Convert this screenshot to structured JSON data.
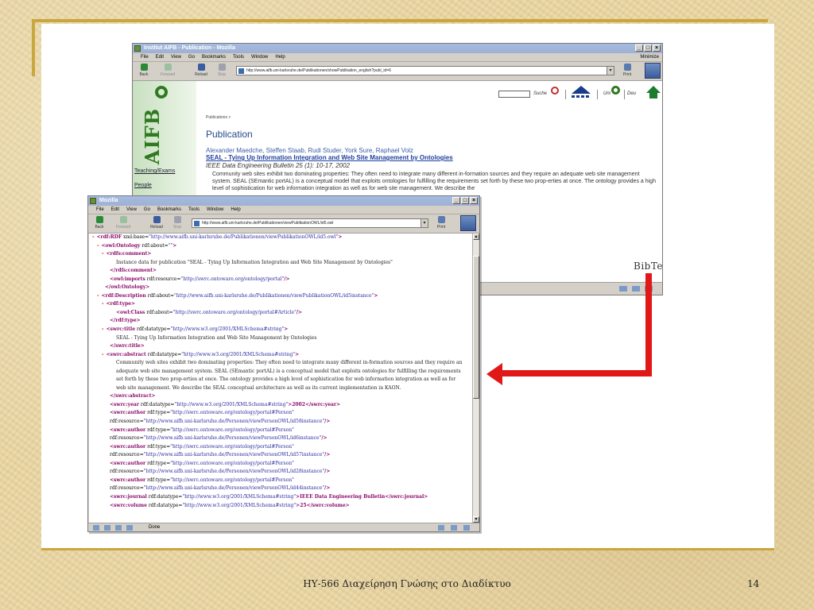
{
  "slide": {
    "footer_title": "ΗΥ-566 Διαχείρηση Γνώσης στο Διαδίκτυο",
    "page_number": "14",
    "accent_color": "#c9a63e",
    "arrow_color": "#e01818"
  },
  "browser1": {
    "title": "Institut AIFB - Publication - Mozilla",
    "menu": [
      "File",
      "Edit",
      "View",
      "Go",
      "Bookmarks",
      "Tools",
      "Window",
      "Help"
    ],
    "minimize_label": "Minimize",
    "toolbar": {
      "back": "Back",
      "forward": "Forward",
      "reload": "Reload",
      "stop": "Stop",
      "print": "Print"
    },
    "url": "http://www.aifb.uni-karlsruhe.de/Publikationen/showPublikation_english?publ_id=6",
    "sidebar": {
      "logo_text": "AIFB",
      "links": [
        "Teaching/Exams",
        "People"
      ]
    },
    "nav": {
      "search_label": "Suche",
      "uni_label": "Uni",
      "lang_label": "Deu"
    },
    "page": {
      "breadcrumb": "Publications >",
      "heading": "Publication",
      "authors": "Alexander Maedche, Steffen Staab, Rudi Studer, York Sure, Raphael Volz",
      "title_link": "SEAL - Tying Up Information Integration and Web Site Management by Ontologies",
      "venue": "IEEE Data Engineering Bulletin 25 (1): 10-17, 2002",
      "abstract": "Community web sites exhibit two dominating properties: They often need to integrate many different in-formation sources and they require an adequate web site management system. SEAL (SEmantic portAL) is a conceptual model that exploits ontologies for fulfilling the requirements set forth by these two prop-erties at once. The ontology provides a high level of sophistication for web information integration as well as for web site management. We describe the",
      "bibtex_label": "BibTeX"
    }
  },
  "browser2": {
    "title": "Mozilla",
    "menu": [
      "File",
      "Edit",
      "View",
      "Go",
      "Bookmarks",
      "Tools",
      "Window",
      "Help"
    ],
    "toolbar": {
      "back": "Back",
      "forward": "Forward",
      "reload": "Reload",
      "stop": "Stop",
      "print": "Print"
    },
    "url": "http://www.aifb.uni-karlsruhe.de/Publikationen/viewPublikationOWL/id5.owl",
    "status_text": "Done",
    "xml": {
      "l1": {
        "tag": "<rdf:RDF",
        "att": " xml:base=",
        "val": "\"http://www.aifb.uni-karlsruhe.de/Publikationen/viewPublikationOWL/id5.owl\"",
        "end": ">"
      },
      "l2": {
        "tag": "<owl:Ontology",
        "att": " rdf:about=",
        "val": "\"\"",
        "end": ">"
      },
      "l3": {
        "tag": "<rdfs:comment>"
      },
      "l4": {
        "text": "Instance data for publication \"SEAL - Tying Up Information Integration and Web Site Management by Ontologies\""
      },
      "l5": {
        "tag": "</rdfs:comment>"
      },
      "l6": {
        "tag": "<owl:imports",
        "att": " rdf:resource=",
        "val": "\"http://swrc.ontoware.org/ontology/portal\"",
        "end": "/>"
      },
      "l7": {
        "tag": "</owl:Ontology>"
      },
      "l8": {
        "tag": "<rdf:Description",
        "att": " rdf:about=",
        "val": "\"http://www.aifb.uni-karlsruhe.de/Publikationen/viewPublikationOWL/id5instance\"",
        "end": ">"
      },
      "l9": {
        "tag": "<rdf:type>"
      },
      "l10": {
        "tag": "<owl:Class",
        "att": " rdf:about=",
        "val": "\"http://swrc.ontoware.org/ontology/portal#Article\"",
        "end": "/>"
      },
      "l11": {
        "tag": "</rdf:type>"
      },
      "l12": {
        "tag": "<swrc:title",
        "att": " rdf:datatype=",
        "val": "\"http://www.w3.org/2001/XMLSchema#string\"",
        "end": ">"
      },
      "l13": {
        "text": "SEAL - Tying Up Information Integration and Web Site Management by Ontologies"
      },
      "l14": {
        "tag": "</swrc:title>"
      },
      "l15": {
        "tag": "<swrc:abstract",
        "att": " rdf:datatype=",
        "val": "\"http://www.w3.org/2001/XMLSchema#string\"",
        "end": ">"
      },
      "l16": {
        "text": "Community web sites exhibit two dominating properties: They often need to integrate many different in-formation sources and they require an"
      },
      "l17": {
        "text": "adequate web site management system. SEAL (SEmantic portAL) is a conceptual model that exploits ontologies for fulfilling the requirements"
      },
      "l18": {
        "text": "set forth by these two prop-erties at once. The ontology provides a high level of sophistication for web information integration as well as for"
      },
      "l19": {
        "text": "web site management. We describe the SEAL conceptual architecture as well as its current implementation in KAON."
      },
      "l20": {
        "tag": "</swrc:abstract>"
      },
      "l21": {
        "tag": "<swrc:year",
        "att": " rdf:datatype=",
        "val": "\"http://www.w3.org/2001/XMLSchema#string\"",
        "end": ">2002</swrc:year>"
      },
      "l22": {
        "tag": "<swrc:author",
        "att": " rdf:type=",
        "val": "\"http://swrc.ontoware.org/ontology/portal#Person\""
      },
      "l23": {
        "att": "rdf:resource=",
        "val": "\"http://www.aifb.uni-karlsruhe.de/Personen/viewPersonOWL/id58instance\"",
        "end": "/>"
      },
      "l24": {
        "tag": "<swrc:author",
        "att": " rdf:type=",
        "val": "\"http://swrc.ontoware.org/ontology/portal#Person\""
      },
      "l25": {
        "att": "rdf:resource=",
        "val": "\"http://www.aifb.uni-karlsruhe.de/Personen/viewPersonOWL/id6instance\"",
        "end": "/>"
      },
      "l26": {
        "tag": "<swrc:author",
        "att": " rdf:type=",
        "val": "\"http://swrc.ontoware.org/ontology/portal#Person\""
      },
      "l27": {
        "att": "rdf:resource=",
        "val": "\"http://www.aifb.uni-karlsruhe.de/Personen/viewPersonOWL/id57instance\"",
        "end": "/>"
      },
      "l28": {
        "tag": "<swrc:author",
        "att": " rdf:type=",
        "val": "\"http://swrc.ontoware.org/ontology/portal#Person\""
      },
      "l29": {
        "att": "rdf:resource=",
        "val": "\"http://www.aifb.uni-karlsruhe.de/Personen/viewPersonOWL/id28instance\"",
        "end": "/>"
      },
      "l30": {
        "tag": "<swrc:author",
        "att": " rdf:type=",
        "val": "\"http://swrc.ontoware.org/ontology/portal#Person\""
      },
      "l31": {
        "att": "rdf:resource=",
        "val": "\"http://www.aifb.uni-karlsruhe.de/Personen/viewPersonOWL/id44instance\"",
        "end": "/>"
      },
      "l32": {
        "tag": "<swrc:journal",
        "att": " rdf:datatype=",
        "val": "\"http://www.w3.org/2001/XMLSchema#string\"",
        "end": ">IEEE Data Engineering Bulletin</swrc:journal>"
      },
      "l33": {
        "tag": "<swrc:volume",
        "att": " rdf:datatype=",
        "val": "\"http://www.w3.org/2001/XMLSchema#string\"",
        "end": ">25</swrc:volume>"
      }
    }
  }
}
